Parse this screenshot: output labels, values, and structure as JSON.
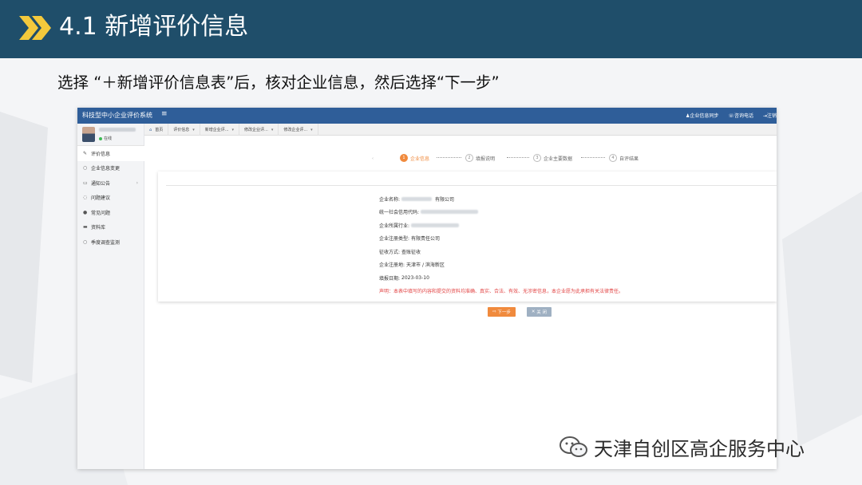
{
  "slide": {
    "title": "4.1 新增评价信息",
    "instruction": "选择 “＋新增评价信息表”后，核对企业信息，然后选择“下一步”",
    "watermark": "天津自创区高企服务中心",
    "colors": {
      "banner": "#1f4e6a",
      "chevron": "#f3c93c",
      "accent": "#f08a3d",
      "decl": "#e24444",
      "appheader": "#2f5e99"
    }
  },
  "app": {
    "title": "科技型中小企业评价系统",
    "menu_icon": "hamburger-icon",
    "header_links": [
      {
        "icon": "user-icon",
        "label": "企业信息同步"
      },
      {
        "icon": "phone-icon",
        "label": "咨询电话"
      },
      {
        "icon": "exit-icon",
        "label": "注销"
      }
    ],
    "user": {
      "status": "在线"
    },
    "sidebar": [
      {
        "icon": "edit-icon",
        "label": "评价信息",
        "active": true
      },
      {
        "icon": "circle-icon",
        "label": "企业信息变更"
      },
      {
        "icon": "notice-icon",
        "label": "通知公告",
        "has_arrow": true
      },
      {
        "icon": "chat-icon",
        "label": "问题建议"
      },
      {
        "icon": "question-icon",
        "label": "常见问题"
      },
      {
        "icon": "folder-icon",
        "label": "资料库"
      },
      {
        "icon": "circle-icon",
        "label": "季度调查监测"
      }
    ],
    "tabs": [
      {
        "label": "首页",
        "icon": "home-icon",
        "closable": false
      },
      {
        "label": "评价信息",
        "closable": true
      },
      {
        "label": "新增企业评...",
        "closable": true
      },
      {
        "label": "修改企业评...",
        "closable": true
      },
      {
        "label": "修改企业评...",
        "closable": true
      }
    ],
    "steps": [
      {
        "num": "1",
        "label": "企业信息",
        "active": true
      },
      {
        "num": "2",
        "label": "填报说明",
        "active": false
      },
      {
        "num": "3",
        "label": "企业主要数据",
        "active": false
      },
      {
        "num": "4",
        "label": "自评结果",
        "active": false
      }
    ],
    "fields": [
      {
        "label": "企业名称:",
        "value": "有限公司"
      },
      {
        "label": "统一社会信用代码:",
        "value": ""
      },
      {
        "label": "企业所属行业:",
        "value": ""
      },
      {
        "label": "企业注册类型:",
        "value": "有限责任公司"
      },
      {
        "label": "征收方式:",
        "value": "查账征收"
      },
      {
        "label": "企业注册地:",
        "value": "天津市 / 滨海新区"
      },
      {
        "label": "填报日期:",
        "value": "2023-03-10"
      }
    ],
    "declaration": "声明：本表中填写的内容和提交的资料均准确、真实、合法、有效、无涉密信息，本企业愿为此承担有关法律责任。",
    "buttons": {
      "next": "下一步",
      "close": "关 闭"
    }
  }
}
